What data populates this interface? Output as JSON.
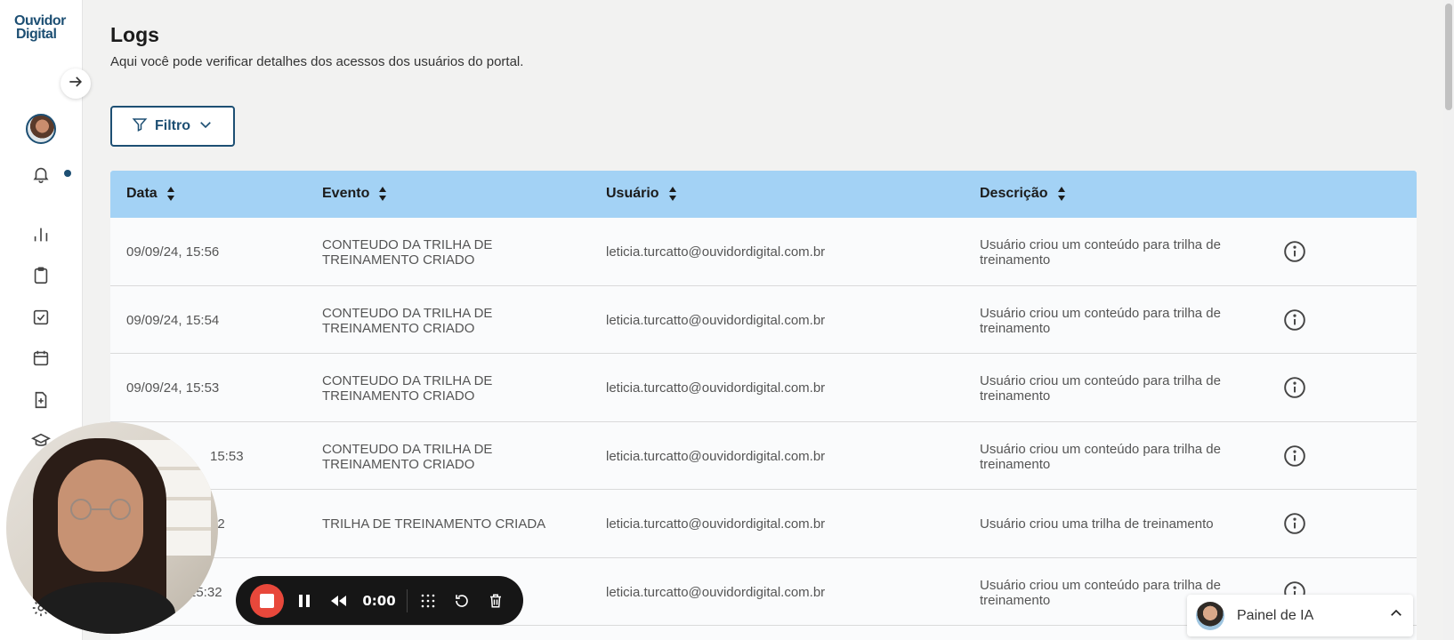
{
  "brand": {
    "logo_line1": "Ouvidor",
    "logo_line2": "Digital"
  },
  "sidebar": {
    "icons": [
      "arrow-right-icon",
      "bell-icon",
      "bar-chart-icon",
      "clipboard-icon",
      "checkbox-icon",
      "calendar-icon",
      "file-plus-icon",
      "graduation-cap-icon",
      "gear-icon"
    ]
  },
  "header": {
    "title": "Logs",
    "subtitle": "Aqui você pode verificar detalhes dos acessos dos usuários do portal."
  },
  "filter": {
    "label": "Filtro"
  },
  "table": {
    "columns": [
      "Data",
      "Evento",
      "Usuário",
      "Descrição"
    ],
    "rows": [
      {
        "date": "09/09/24, 15:56",
        "event": "CONTEUDO DA TRILHA DE TREINAMENTO CRIADO",
        "user": "leticia.turcatto@ouvidordigital.com.br",
        "desc": "Usuário criou um conteúdo para trilha de treinamento"
      },
      {
        "date": "09/09/24, 15:54",
        "event": "CONTEUDO DA TRILHA DE TREINAMENTO CRIADO",
        "user": "leticia.turcatto@ouvidordigital.com.br",
        "desc": "Usuário criou um conteúdo para trilha de treinamento"
      },
      {
        "date": "09/09/24, 15:53",
        "event": "CONTEUDO DA TRILHA DE TREINAMENTO CRIADO",
        "user": "leticia.turcatto@ouvidordigital.com.br",
        "desc": "Usuário criou um conteúdo para trilha de treinamento"
      },
      {
        "date": "15:53",
        "event": "CONTEUDO DA TRILHA DE TREINAMENTO CRIADO",
        "user": "leticia.turcatto@ouvidordigital.com.br",
        "desc": "Usuário criou um conteúdo para trilha de treinamento"
      },
      {
        "date": "52",
        "event": "TRILHA DE TREINAMENTO CRIADA",
        "user": "leticia.turcatto@ouvidordigital.com.br",
        "desc": "Usuário criou uma trilha de treinamento"
      },
      {
        "date": "15:32",
        "event": "",
        "user": "leticia.turcatto@ouvidordigital.com.br",
        "desc": "Usuário criou um conteúdo para trilha de treinamento"
      }
    ]
  },
  "recorder": {
    "time": "0:00"
  },
  "ai_panel": {
    "label": "Painel de IA"
  },
  "colors": {
    "primary": "#1d4f73",
    "header_bg": "#a3d2f5",
    "record": "#e8483b",
    "page_bg": "#f2f2f1"
  }
}
